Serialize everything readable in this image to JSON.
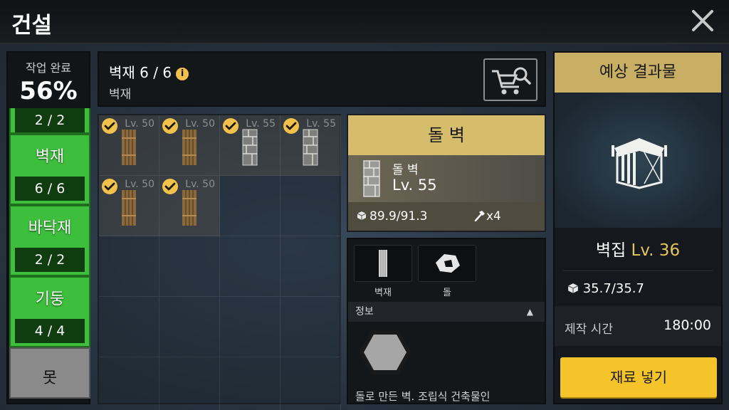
{
  "app": {
    "title": "건설"
  },
  "progress": {
    "label": "작업 완료",
    "value": "56%"
  },
  "categories": [
    {
      "label": "",
      "count": "2 / 2",
      "state": "complete"
    },
    {
      "label": "벽재",
      "count": "6 / 6",
      "state": "complete"
    },
    {
      "label": "바닥재",
      "count": "2 / 2",
      "state": "complete"
    },
    {
      "label": "기둥",
      "count": "4 / 4",
      "state": "complete"
    },
    {
      "label": "못",
      "count": "",
      "state": "incomplete"
    }
  ],
  "header": {
    "title": "벽재 6 / 6",
    "subtitle": "벽재",
    "info_icon": "i"
  },
  "grid": {
    "items": [
      {
        "level": "Lv. 50",
        "kind": "wood-plank",
        "checked": true
      },
      {
        "level": "Lv. 50",
        "kind": "wood-plank",
        "checked": true
      },
      {
        "level": "Lv. 55",
        "kind": "stone-wall",
        "checked": true
      },
      {
        "level": "Lv. 55",
        "kind": "stone-wall",
        "checked": true
      },
      {
        "level": "Lv. 50",
        "kind": "wood-plank",
        "checked": true
      },
      {
        "level": "Lv. 50",
        "kind": "wood-plank",
        "checked": true
      }
    ]
  },
  "detail": {
    "title": "돌 벽",
    "name": "돌 벽",
    "level": "Lv. 55",
    "durability": "89.9/91.3",
    "hammer": "x4"
  },
  "materials": {
    "items": [
      {
        "label": "벽재",
        "icon": "wood-plank-icon"
      },
      {
        "label": "돌",
        "icon": "stone-icon"
      }
    ],
    "info_label": "정보",
    "description": "돌로 만든 벽. 조립식 건축물인"
  },
  "result": {
    "header": "예상 결과물",
    "name": "벽집",
    "level": "Lv. 36",
    "durability": "35.7/35.7",
    "time_label": "제작 시간",
    "time_value": "180:00",
    "button_label": "재료 넣기"
  },
  "colors": {
    "accent_gold": "#d6bd6b",
    "button_yellow": "#f4c42a",
    "complete_green": "#3dbf3d",
    "check_yellow": "#f2c14b"
  }
}
